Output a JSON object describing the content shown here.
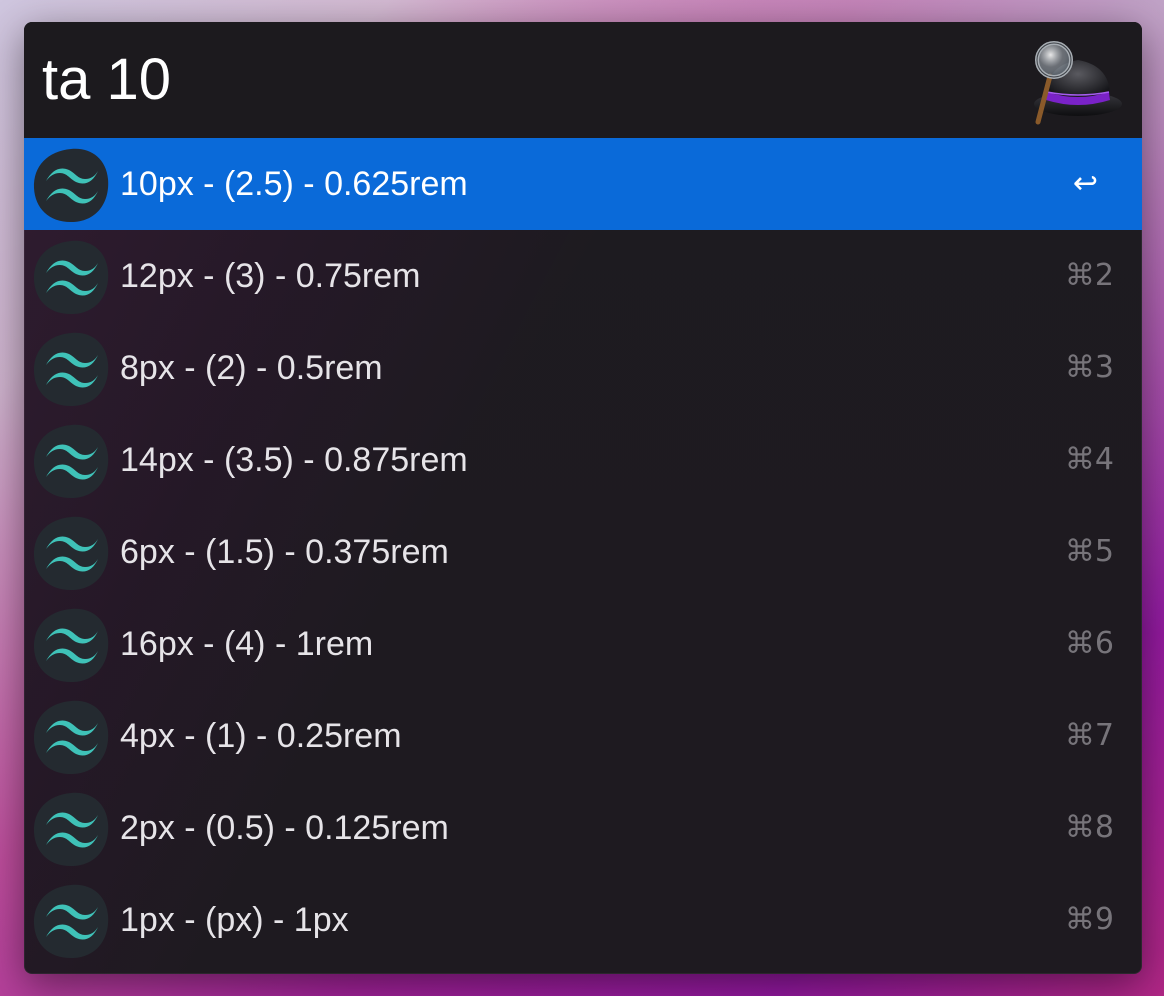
{
  "search": {
    "query": "ta 10"
  },
  "app": {
    "logo_icon": "alfred-hat-icon"
  },
  "results": [
    {
      "title": "10px - (2.5) - 0.625rem",
      "shortcut": "↩",
      "selected": true
    },
    {
      "title": "12px - (3) - 0.75rem",
      "shortcut": "⌘2",
      "selected": false
    },
    {
      "title": "8px - (2) - 0.5rem",
      "shortcut": "⌘3",
      "selected": false
    },
    {
      "title": "14px - (3.5) - 0.875rem",
      "shortcut": "⌘4",
      "selected": false
    },
    {
      "title": "6px - (1.5) - 0.375rem",
      "shortcut": "⌘5",
      "selected": false
    },
    {
      "title": "16px - (4) - 1rem",
      "shortcut": "⌘6",
      "selected": false
    },
    {
      "title": "4px - (1) - 0.25rem",
      "shortcut": "⌘7",
      "selected": false
    },
    {
      "title": "2px - (0.5) - 0.125rem",
      "shortcut": "⌘8",
      "selected": false
    },
    {
      "title": "1px - (px) - 1px",
      "shortcut": "⌘9",
      "selected": false
    }
  ],
  "result_icon": "tailwind-icon",
  "colors": {
    "selection": "#0a6ad9",
    "tailwind_teal": "#38bdb6",
    "panel": "#1c1a1e"
  }
}
